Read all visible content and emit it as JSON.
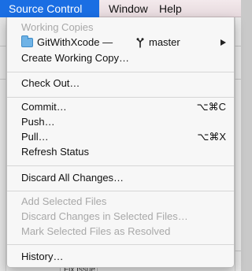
{
  "menubar": {
    "items": [
      {
        "label": "Source Control",
        "active": true
      },
      {
        "label": "Window"
      },
      {
        "label": "Help"
      }
    ]
  },
  "source_control_menu": {
    "working_copies": {
      "header": "Working Copies",
      "repo": "GitWithXcode —",
      "branch": "master",
      "repo_icon": "folder-icon",
      "branch_icon": "branch-icon"
    },
    "create_working_copy": "Create Working Copy…",
    "check_out": "Check Out…",
    "commit": {
      "label": "Commit…",
      "shortcut": "⌥⌘C"
    },
    "push": "Push…",
    "pull": {
      "label": "Pull…",
      "shortcut": "⌥⌘X"
    },
    "refresh_status": "Refresh Status",
    "discard_all_changes": "Discard All Changes…",
    "add_selected_files": "Add Selected Files",
    "discard_changes_selected": "Discard Changes in Selected Files…",
    "mark_resolved": "Mark Selected Files as Resolved",
    "history": "History…"
  },
  "background": {
    "fix_issue_tab": "Fix Issue"
  },
  "colors": {
    "menubar_active": "#1a6ee3",
    "disabled_text": "#a8a8a8"
  }
}
